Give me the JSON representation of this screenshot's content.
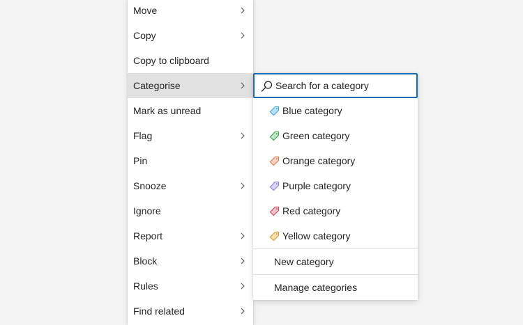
{
  "colors": {
    "page_background": "#f3f3f3",
    "menu_background": "#ffffff",
    "active_item_background": "#e1e1e1",
    "search_border": "#1a6bb5",
    "text": "#252423"
  },
  "context_menu": {
    "items": [
      {
        "label": "Move",
        "has_submenu": true
      },
      {
        "label": "Copy",
        "has_submenu": true
      },
      {
        "label": "Copy to clipboard",
        "has_submenu": false
      },
      {
        "label": "Categorise",
        "has_submenu": true,
        "active": true
      },
      {
        "label": "Mark as unread",
        "has_submenu": false
      },
      {
        "label": "Flag",
        "has_submenu": true
      },
      {
        "label": "Pin",
        "has_submenu": false
      },
      {
        "label": "Snooze",
        "has_submenu": true
      },
      {
        "label": "Ignore",
        "has_submenu": false
      },
      {
        "label": "Report",
        "has_submenu": true
      },
      {
        "label": "Block",
        "has_submenu": true
      },
      {
        "label": "Rules",
        "has_submenu": true
      },
      {
        "label": "Find related",
        "has_submenu": true
      }
    ]
  },
  "category_submenu": {
    "search_placeholder": "Search for a category",
    "categories": [
      {
        "label": "Blue category",
        "icon": "tag-icon",
        "color": "#3aa7d9"
      },
      {
        "label": "Green category",
        "icon": "tag-icon",
        "color": "#3aa550"
      },
      {
        "label": "Orange category",
        "icon": "tag-icon",
        "color": "#e07a4f"
      },
      {
        "label": "Purple category",
        "icon": "tag-icon",
        "color": "#8f7fd3"
      },
      {
        "label": "Red category",
        "icon": "tag-icon",
        "color": "#d9445b"
      },
      {
        "label": "Yellow category",
        "icon": "tag-icon",
        "color": "#d99a2b"
      }
    ],
    "new_category_label": "New category",
    "manage_categories_label": "Manage categories"
  }
}
